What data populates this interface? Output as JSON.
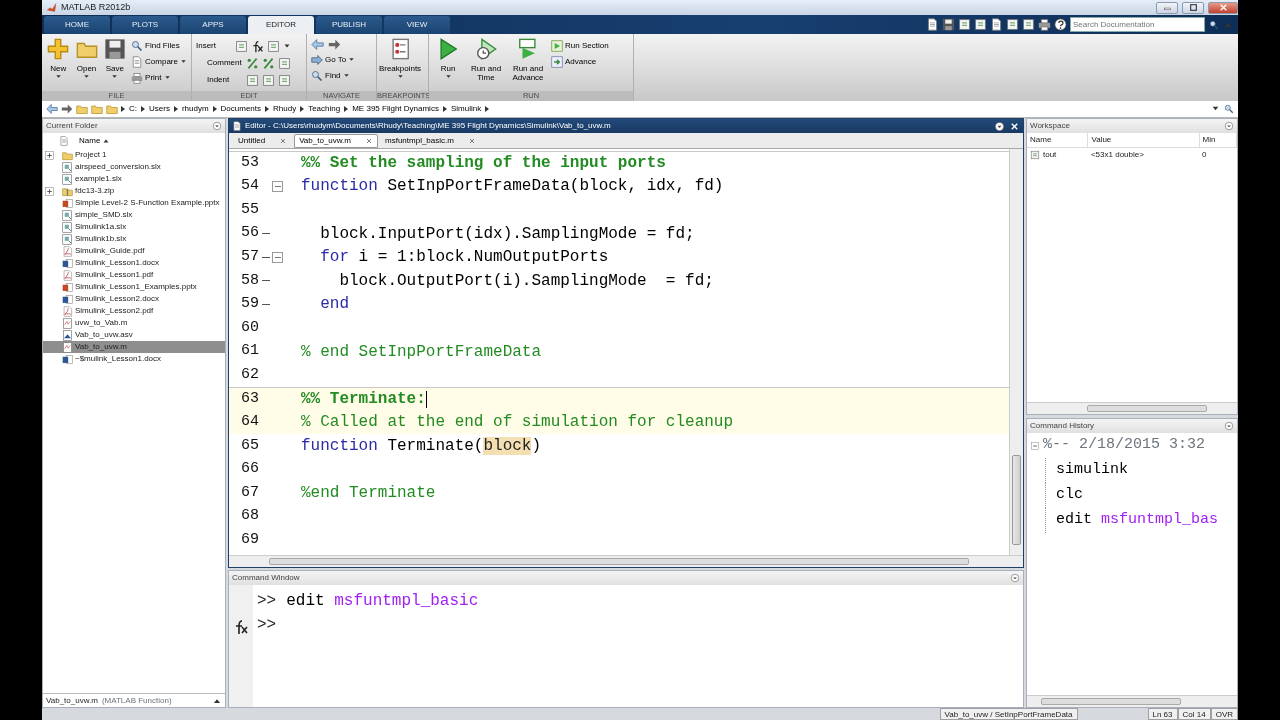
{
  "window": {
    "title": "MATLAB R2012b"
  },
  "toolstrip": {
    "tabs": [
      {
        "label": "HOME",
        "selected": false
      },
      {
        "label": "PLOTS",
        "selected": false
      },
      {
        "label": "APPS",
        "selected": false
      },
      {
        "label": "EDITOR",
        "selected": true
      },
      {
        "label": "PUBLISH",
        "selected": false
      },
      {
        "label": "VIEW",
        "selected": false
      }
    ],
    "search": {
      "placeholder": "Search Documentation"
    },
    "groups": [
      {
        "kind": "file",
        "label": "FILE",
        "large": [
          "New",
          "Open",
          "Save"
        ],
        "small": [
          "Find Files",
          "Compare",
          "Print"
        ]
      },
      {
        "kind": "edit",
        "label": "EDIT",
        "small": [
          "Insert",
          "Comment",
          "Indent"
        ]
      },
      {
        "kind": "navigate",
        "label": "NAVIGATE",
        "small": [
          "Go To",
          "Find"
        ]
      },
      {
        "kind": "breakpoints",
        "label": "BREAKPOINTS",
        "large": [
          "Breakpoints"
        ]
      },
      {
        "kind": "run",
        "label": "RUN",
        "large": [
          "Run",
          "Run and Time",
          "Run and Advance"
        ],
        "small": [
          "Run Section",
          "Advance"
        ]
      }
    ]
  },
  "address_bar": {
    "path": [
      "C:",
      "Users",
      "rhudym",
      "Documents",
      "Rhudy",
      "Teaching",
      "ME 395 Flight Dynamics",
      "Simulink"
    ]
  },
  "current_folder": {
    "title": "Current Folder",
    "column": "Name",
    "items": [
      {
        "name": "Project 1",
        "kind": "folder",
        "expandable": true,
        "selected": false
      },
      {
        "name": "airspeed_conversion.slx",
        "kind": "model",
        "expandable": false,
        "selected": false
      },
      {
        "name": "example1.slx",
        "kind": "model",
        "expandable": false,
        "selected": false
      },
      {
        "name": "fdc13-3.zip",
        "kind": "zip",
        "expandable": true,
        "selected": false
      },
      {
        "name": "Simple Level-2 S-Function Example.pptx",
        "kind": "slides",
        "expandable": false,
        "selected": false
      },
      {
        "name": "simple_SMD.slx",
        "kind": "model",
        "expandable": false,
        "selected": false
      },
      {
        "name": "Simulink1a.slx",
        "kind": "model",
        "expandable": false,
        "selected": false
      },
      {
        "name": "Simulink1b.slx",
        "kind": "model",
        "expandable": false,
        "selected": false
      },
      {
        "name": "Simulink_Guide.pdf",
        "kind": "pdf",
        "expandable": false,
        "selected": false
      },
      {
        "name": "Simulink_Lesson1.docx",
        "kind": "doc",
        "expandable": false,
        "selected": false
      },
      {
        "name": "Simulink_Lesson1.pdf",
        "kind": "pdf",
        "expandable": false,
        "selected": false
      },
      {
        "name": "Simulink_Lesson1_Examples.pptx",
        "kind": "slides",
        "expandable": false,
        "selected": false
      },
      {
        "name": "Simulink_Lesson2.docx",
        "kind": "doc",
        "expandable": false,
        "selected": false
      },
      {
        "name": "Simulink_Lesson2.pdf",
        "kind": "pdf",
        "expandable": false,
        "selected": false
      },
      {
        "name": "uvw_to_Vab.m",
        "kind": "script",
        "expandable": false,
        "selected": false
      },
      {
        "name": "Vab_to_uvw.asv",
        "kind": "autosave",
        "expandable": false,
        "selected": false
      },
      {
        "name": "Vab_to_uvw.m",
        "kind": "script",
        "expandable": false,
        "selected": true
      },
      {
        "name": "~$mulink_Lesson1.docx",
        "kind": "doc",
        "expandable": false,
        "selected": false
      }
    ],
    "details": {
      "name": "Vab_to_uvw.m",
      "type": "(MATLAB Function)"
    }
  },
  "editor": {
    "title": "Editor - C:\\Users\\rhudym\\Documents\\Rhudy\\Teaching\\ME 395 Flight Dynamics\\Simulink\\Vab_to_uvw.m",
    "tabs": [
      {
        "label": "Untitled",
        "selected": false
      },
      {
        "label": "Vab_to_uvw.m",
        "selected": true
      },
      {
        "label": "msfuntmpl_basic.m",
        "selected": false
      }
    ],
    "lines": [
      {
        "number": "53",
        "dash": false,
        "fold": false,
        "current_cell": false,
        "cursor": false,
        "segments": [
          {
            "kind": "cell_title",
            "text": "%% Set the sampling of the input ports"
          }
        ]
      },
      {
        "number": "54",
        "dash": false,
        "fold": true,
        "current_cell": false,
        "cursor": false,
        "segments": [
          {
            "kind": "keyword",
            "text": "function"
          },
          {
            "kind": "plain",
            "text": " SetInpPortFrameData(block, idx, fd)"
          }
        ]
      },
      {
        "number": "55",
        "dash": false,
        "fold": false,
        "current_cell": false,
        "cursor": false
      },
      {
        "number": "56",
        "dash": true,
        "fold": false,
        "current_cell": false,
        "cursor": false,
        "segments": [
          {
            "kind": "plain",
            "text": "  block.InputPort(idx).SamplingMode = fd;"
          }
        ]
      },
      {
        "number": "57",
        "dash": true,
        "fold": true,
        "current_cell": false,
        "cursor": false,
        "segments": [
          {
            "kind": "keyword",
            "text": "  for"
          },
          {
            "kind": "plain",
            "text": " i = 1:block.NumOutputPorts"
          }
        ]
      },
      {
        "number": "58",
        "dash": true,
        "fold": false,
        "current_cell": false,
        "cursor": false,
        "segments": [
          {
            "kind": "plain",
            "text": "    block.OutputPort(i).SamplingMode  = fd;"
          }
        ]
      },
      {
        "number": "59",
        "dash": true,
        "fold": false,
        "current_cell": false,
        "cursor": false,
        "segments": [
          {
            "kind": "keyword",
            "text": "  end"
          }
        ]
      },
      {
        "number": "60",
        "dash": false,
        "fold": false,
        "current_cell": false,
        "cursor": false
      },
      {
        "number": "61",
        "dash": false,
        "fold": false,
        "current_cell": false,
        "cursor": false,
        "segments": [
          {
            "kind": "comment",
            "text": "% end SetInpPortFrameData"
          }
        ]
      },
      {
        "number": "62",
        "dash": false,
        "fold": false,
        "current_cell": false,
        "cursor": false
      },
      {
        "number": "63",
        "dash": false,
        "fold": false,
        "current_cell": true,
        "cursor": true,
        "segments": [
          {
            "kind": "cell_title",
            "text": "%% Terminate:"
          }
        ]
      },
      {
        "number": "64",
        "dash": false,
        "fold": false,
        "current_cell": true,
        "cursor": false,
        "segments": [
          {
            "kind": "comment",
            "text": "% Called at the end of simulation for cleanup"
          }
        ]
      },
      {
        "number": "65",
        "dash": false,
        "fold": false,
        "current_cell": false,
        "cursor": false,
        "segments": [
          {
            "kind": "keyword",
            "text": "function"
          },
          {
            "kind": "plain",
            "text": " Terminate("
          },
          {
            "kind": "match",
            "text": "block"
          },
          {
            "kind": "plain",
            "text": ")"
          }
        ]
      },
      {
        "number": "66",
        "dash": false,
        "fold": false,
        "current_cell": false,
        "cursor": false
      },
      {
        "number": "67",
        "dash": false,
        "fold": false,
        "current_cell": false,
        "cursor": false,
        "segments": [
          {
            "kind": "comment",
            "text": "%end Terminate"
          }
        ]
      },
      {
        "number": "68",
        "dash": false,
        "fold": false,
        "current_cell": false,
        "cursor": false
      },
      {
        "number": "69",
        "dash": false,
        "fold": false,
        "current_cell": false,
        "cursor": false
      }
    ]
  },
  "command_window": {
    "title": "Command Window",
    "lines": [
      {
        "prompt": ">>",
        "segments": [
          {
            "kind": "plain",
            "text": "edit "
          },
          {
            "kind": "string",
            "text": "msfuntmpl_basic"
          }
        ]
      },
      {
        "prompt": ">>"
      }
    ]
  },
  "workspace": {
    "title": "Workspace",
    "columns": [
      "Name",
      "Value",
      "Min"
    ],
    "rows": [
      {
        "name": "tout",
        "value": "<53x1 double>",
        "min": "0"
      }
    ]
  },
  "command_history": {
    "title": "Command History",
    "session": "%-- 2/18/2015 3:32",
    "entries": [
      {
        "segments": [
          {
            "kind": "plain",
            "text": "simulink"
          }
        ]
      },
      {
        "segments": [
          {
            "kind": "plain",
            "text": "clc"
          }
        ]
      },
      {
        "segments": [
          {
            "kind": "plain",
            "text": "edit "
          },
          {
            "kind": "string",
            "text": "msfuntmpl_bas"
          }
        ]
      }
    ]
  },
  "status_bar": {
    "context": "Vab_to_uvw / SetInpPortFrameData",
    "line": "Ln  63",
    "column": "Col  14",
    "mode": "OVR"
  }
}
